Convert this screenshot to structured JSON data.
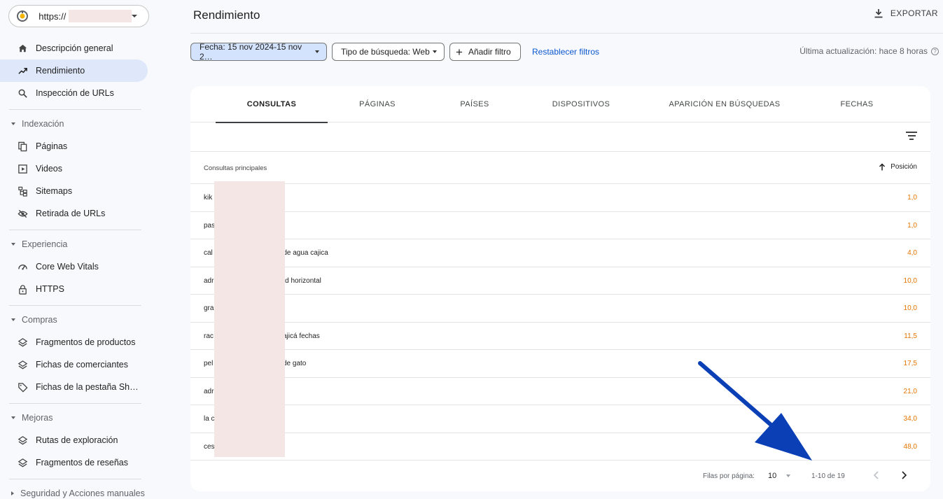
{
  "sidebar": {
    "property": {
      "url": "https://",
      "icon": "search-console-logo"
    },
    "items": [
      {
        "label": "Descripción general",
        "icon": "home-icon"
      },
      {
        "label": "Rendimiento",
        "icon": "trending-up-icon",
        "active": true
      },
      {
        "label": "Inspección de URLs",
        "icon": "search-icon"
      }
    ],
    "sections": {
      "indexacion": {
        "title": "Indexación",
        "items": [
          {
            "label": "Páginas",
            "icon": "pages-icon"
          },
          {
            "label": "Videos",
            "icon": "video-icon"
          },
          {
            "label": "Sitemaps",
            "icon": "sitemap-icon"
          },
          {
            "label": "Retirada de URLs",
            "icon": "eye-off-icon"
          }
        ]
      },
      "experiencia": {
        "title": "Experiencia",
        "items": [
          {
            "label": "Core Web Vitals",
            "icon": "speed-icon"
          },
          {
            "label": "HTTPS",
            "icon": "lock-icon"
          }
        ]
      },
      "compras": {
        "title": "Compras",
        "items": [
          {
            "label": "Fragmentos de productos",
            "icon": "layers-icon"
          },
          {
            "label": "Fichas de comerciantes",
            "icon": "layers-icon"
          },
          {
            "label": "Fichas de la pestaña Sh…",
            "icon": "tag-icon"
          }
        ]
      },
      "mejoras": {
        "title": "Mejoras",
        "items": [
          {
            "label": "Rutas de exploración",
            "icon": "layers-icon"
          },
          {
            "label": "Fragmentos de reseñas",
            "icon": "layers-icon"
          }
        ]
      },
      "seguridad": {
        "title": "Seguridad y Acciones manuales"
      }
    }
  },
  "header": {
    "title": "Rendimiento",
    "export_label": "EXPORTAR"
  },
  "filters": {
    "date": "Fecha: 15 nov 2024-15 nov 2…",
    "search_type": "Tipo de búsqueda: Web",
    "add_filter": "Añadir filtro",
    "reset": "Restablecer filtros",
    "last_update": "Última actualización: hace 8 horas"
  },
  "tabs": [
    "CONSULTAS",
    "PÁGINAS",
    "PAÍSES",
    "DISPOSITIVOS",
    "APARICIÓN EN BÚSQUEDAS",
    "FECHAS"
  ],
  "table": {
    "col_query": "Consultas principales",
    "col_position": "Posición",
    "rows": [
      {
        "query_start": "kik",
        "query_end": "",
        "position": "1,0"
      },
      {
        "query_start": "pas",
        "query_end": "",
        "position": "1,0"
      },
      {
        "query_start": "cal",
        "query_end": "o de agua cajica",
        "position": "4,0"
      },
      {
        "query_start": "adr",
        "query_end": "dad horizontal",
        "position": "10,0"
      },
      {
        "query_start": "gra",
        "query_end": "",
        "position": "10,0"
      },
      {
        "query_start": "rac",
        "query_end": "ajicá fechas",
        "position": "11,5"
      },
      {
        "query_start": "pel",
        "query_end": "de gato",
        "position": "17,5"
      },
      {
        "query_start": "adr",
        "query_end": "",
        "position": "21,0"
      },
      {
        "query_start": "la c",
        "query_end": "",
        "position": "34,0"
      },
      {
        "query_start": "ces",
        "query_end": "",
        "position": "48,0"
      }
    ]
  },
  "pagination": {
    "rows_per_page_label": "Filas por página:",
    "rows_per_page": "10",
    "range": "1-10 de 19"
  },
  "colors": {
    "accent": "#0b57d0",
    "position": "#e37400",
    "annotation_arrow": "#0a3fb5"
  }
}
